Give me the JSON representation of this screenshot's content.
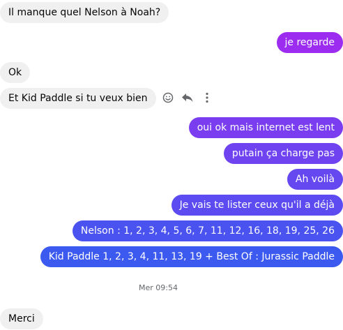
{
  "messages": [
    {
      "id": "m1",
      "text": "Il manque quel Nelson à Noah?"
    },
    {
      "id": "m2",
      "text": "je regarde"
    },
    {
      "id": "m3",
      "text": "Ok"
    },
    {
      "id": "m4",
      "text": "Et Kid Paddle si tu veux bien"
    },
    {
      "id": "m5",
      "text": "oui ok mais internet est lent"
    },
    {
      "id": "m6",
      "text": "putain ça charge pas"
    },
    {
      "id": "m7",
      "text": "Ah voilà"
    },
    {
      "id": "m8",
      "text": "Je vais te lister ceux qu'il a déjà"
    },
    {
      "id": "m9",
      "text": "Nelson : 1, 2, 3, 4, 5, 6, 7, 11, 12, 16, 18, 19, 25, 26"
    },
    {
      "id": "m10",
      "text": "Kid Paddle 1, 2, 3, 4, 11, 13, 19 + Best Of : Jurassic Paddle"
    },
    {
      "id": "m11",
      "text": "Merci"
    }
  ],
  "timestamp": "Mer 09:54",
  "message_actions": [
    "smiley-icon",
    "reply-icon",
    "more-vertical-icon"
  ],
  "colors": {
    "incoming_bubble": "#f0f0f0",
    "outgoing_gradient": [
      "#9b2cf0",
      "#7a3ef0",
      "#5b4bf0",
      "#3d5af0"
    ]
  }
}
